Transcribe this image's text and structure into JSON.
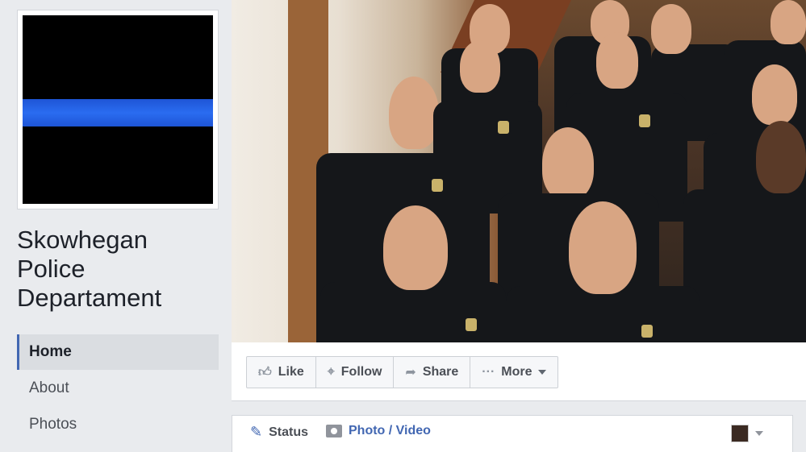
{
  "page": {
    "name_lines": [
      "Skowhegan",
      "Police",
      "Departament"
    ]
  },
  "nav": {
    "items": [
      {
        "label": "Home",
        "active": true
      },
      {
        "label": "About",
        "active": false
      },
      {
        "label": "Photos",
        "active": false
      }
    ]
  },
  "actions": {
    "like": "Like",
    "follow": "Follow",
    "share": "Share",
    "more": "More"
  },
  "composer": {
    "status": "Status",
    "photo_video": "Photo / Video"
  },
  "colors": {
    "accent": "#4267b2",
    "thin_blue_line": "#2a6cf0"
  }
}
